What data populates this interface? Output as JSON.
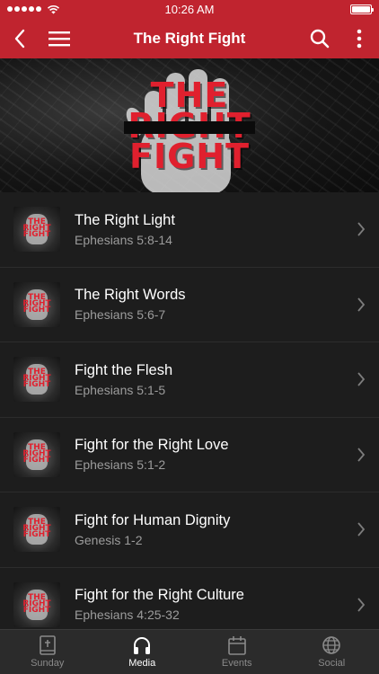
{
  "status_bar": {
    "time": "10:26 AM"
  },
  "header": {
    "title": "The Right Fight"
  },
  "hero": {
    "line1": "THE",
    "line2": "RIGHT",
    "line3": "FIGHT"
  },
  "thumbnail_text": "THE RIGHT FIGHT",
  "sermons": [
    {
      "title": "The Right Light",
      "passage": "Ephesians 5:8-14"
    },
    {
      "title": "The Right Words",
      "passage": "Ephesians 5:6-7"
    },
    {
      "title": "Fight the Flesh",
      "passage": "Ephesians 5:1-5"
    },
    {
      "title": "Fight for the Right Love",
      "passage": "Ephesians 5:1-2"
    },
    {
      "title": "Fight for Human Dignity",
      "passage": "Genesis 1-2"
    },
    {
      "title": "Fight for the Right Culture",
      "passage": "Ephesians 4:25-32"
    }
  ],
  "tabs": [
    {
      "label": "Sunday",
      "icon": "bible-icon"
    },
    {
      "label": "Media",
      "icon": "headphones-icon"
    },
    {
      "label": "Events",
      "icon": "calendar-icon"
    },
    {
      "label": "Social",
      "icon": "globe-icon"
    }
  ],
  "active_tab": "Media",
  "colors": {
    "brand_red": "#c0242f",
    "background": "#1d1d1d",
    "subtitle_gray": "#9c9c9c"
  }
}
